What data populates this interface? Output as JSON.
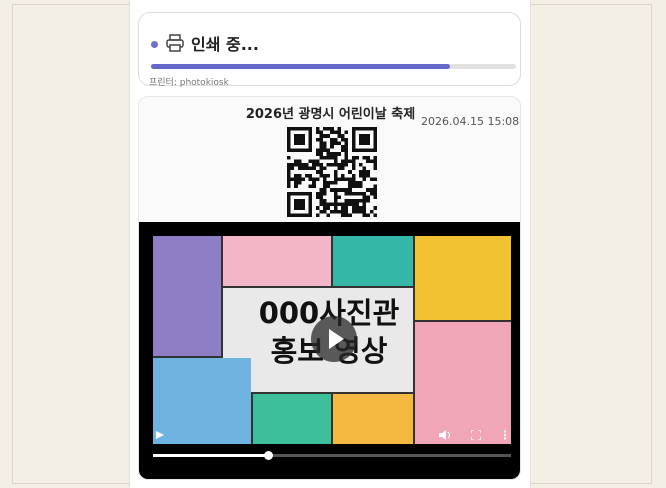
{
  "print_status": {
    "text": "인쇄 중...",
    "progress": 0.82,
    "printer_label": "프린터: photokiosk",
    "accent_color": "#6468c8",
    "icon": "printer-icon"
  },
  "ticket": {
    "title": "2026년 광명시 어린이날 축제",
    "datetime": "2026.04.15 15:08",
    "qr_icon": "qr-code"
  },
  "video": {
    "headline_line1": "000사진관",
    "headline_line2": "홍보 영상",
    "seek_progress": 0.32,
    "controls": [
      "play-icon",
      "volume-icon",
      "fullscreen-icon",
      "more-icon"
    ]
  }
}
